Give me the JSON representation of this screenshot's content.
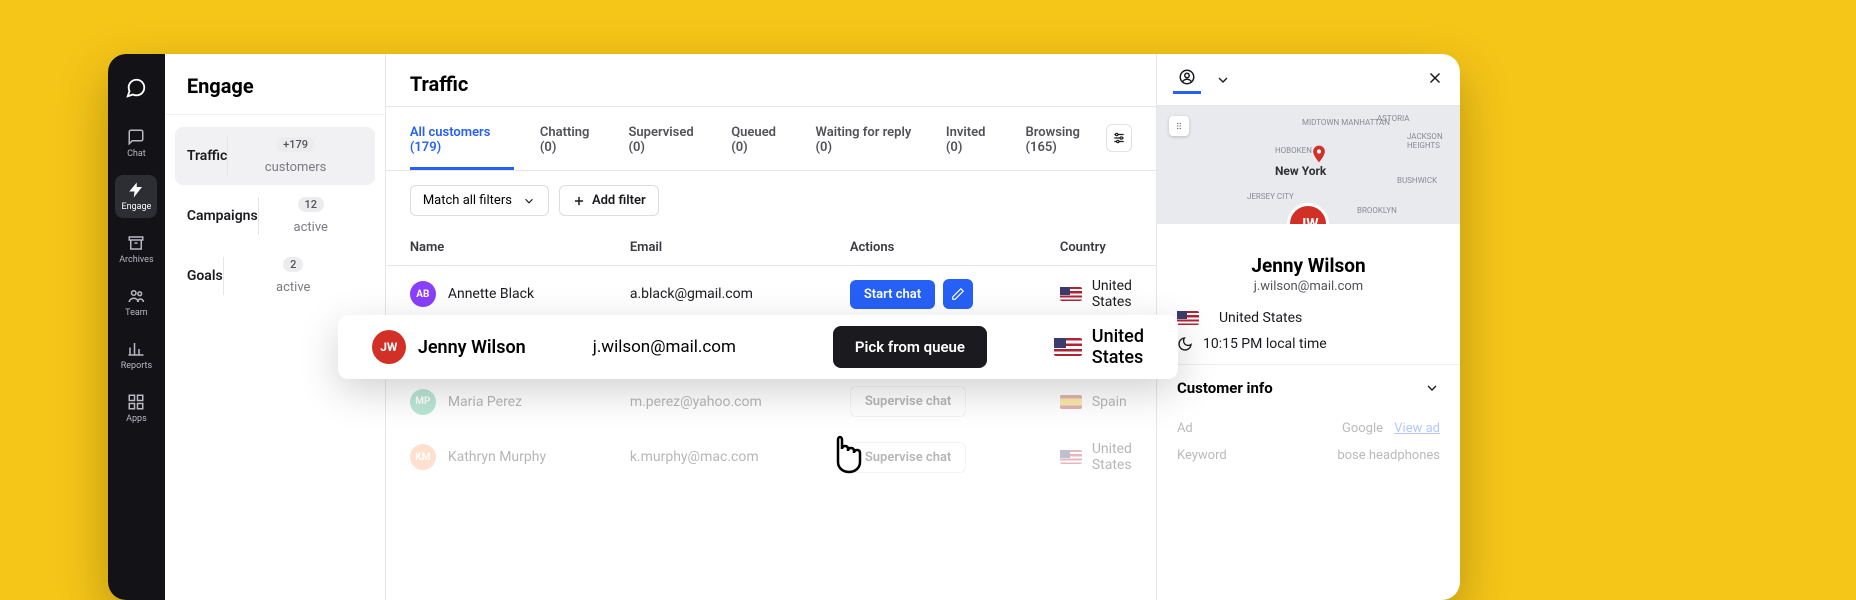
{
  "rail": {
    "items": [
      {
        "label": "Chat"
      },
      {
        "label": "Engage"
      },
      {
        "label": "Archives"
      },
      {
        "label": "Team"
      },
      {
        "label": "Reports"
      },
      {
        "label": "Apps"
      }
    ]
  },
  "engage": {
    "title": "Engage",
    "nav": [
      {
        "label": "Traffic",
        "badge": "+179",
        "meta": "customers"
      },
      {
        "label": "Campaigns",
        "badge": "12",
        "meta": "active"
      },
      {
        "label": "Goals",
        "badge": "2",
        "meta": "active"
      }
    ]
  },
  "traffic": {
    "title": "Traffic",
    "tabs": [
      {
        "label": "All customers",
        "count": "(179)"
      },
      {
        "label": "Chatting",
        "count": "(0)"
      },
      {
        "label": "Supervised",
        "count": "(0)"
      },
      {
        "label": "Queued",
        "count": "(0)"
      },
      {
        "label": "Waiting for reply",
        "count": "(0)"
      },
      {
        "label": "Invited",
        "count": "(0)"
      },
      {
        "label": "Browsing",
        "count": "(165)"
      }
    ],
    "filter_select": "Match all filters",
    "add_filter": "Add filter",
    "columns": {
      "name": "Name",
      "email": "Email",
      "actions": "Actions",
      "country": "Country"
    },
    "rows": [
      {
        "initials": "AB",
        "avatar_color": "#8a3ffc",
        "name": "Annette Black",
        "email": "a.black@gmail.com",
        "action": "Start chat",
        "country": "United States",
        "flag": "us"
      },
      {
        "initials": "JW",
        "avatar_color": "#d22f27",
        "name": "Jenny Wilson",
        "email": "j.wilson@mail.com",
        "action": "Pick from queue",
        "country": "United States",
        "flag": "us"
      },
      {
        "initials": "MP",
        "avatar_color": "#2fb380",
        "name": "Maria Perez",
        "email": "m.perez@yahoo.com",
        "action": "Supervise chat",
        "country": "Spain",
        "flag": "es"
      },
      {
        "initials": "KM",
        "avatar_color": "#ff9e66",
        "name": "Kathryn Murphy",
        "email": "k.murphy@mac.com",
        "action": "Supervise chat",
        "country": "United States",
        "flag": "us"
      }
    ]
  },
  "highlight_action": "Pick from queue",
  "profile": {
    "name": "Jenny Wilson",
    "email": "j.wilson@mail.com",
    "initials": "JW",
    "country": "United States",
    "time": "10:15 PM local time",
    "map_city": "New York",
    "section": "Customer info",
    "ci": [
      {
        "k": "Ad",
        "v": "Google",
        "link": "View ad"
      },
      {
        "k": "Keyword",
        "v": "bose headphones"
      }
    ]
  }
}
